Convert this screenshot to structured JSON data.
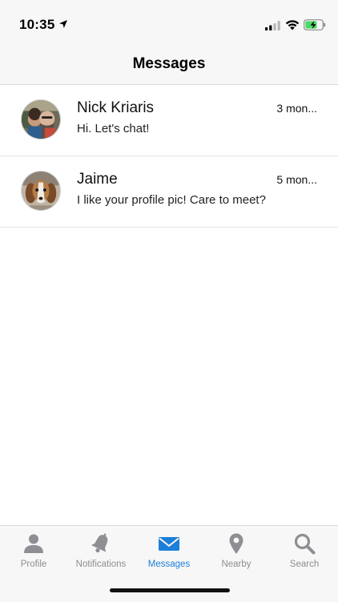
{
  "status_bar": {
    "time": "10:35",
    "icons": [
      "location-arrow-icon",
      "cellular-signal-icon",
      "wifi-icon",
      "battery-charging-icon"
    ],
    "battery_color": "#4cd964"
  },
  "header": {
    "title": "Messages"
  },
  "messages": [
    {
      "name": "Nick Kriaris",
      "time": "3 mon...",
      "preview": " Hi. Let's chat!",
      "avatar": "couple-photo-avatar"
    },
    {
      "name": "Jaime",
      "time": "5 mon...",
      "preview": "I like your profile pic! Care to meet?",
      "avatar": "dog-photo-avatar"
    }
  ],
  "tab_bar": {
    "active_color": "#1c7fd8",
    "inactive_color": "#8e8e93",
    "tabs": [
      {
        "label": "Profile",
        "icon": "person-icon",
        "active": false
      },
      {
        "label": "Notifications",
        "icon": "bell-icon",
        "active": false
      },
      {
        "label": "Messages",
        "icon": "envelope-icon",
        "active": true
      },
      {
        "label": "Nearby",
        "icon": "map-pin-icon",
        "active": false
      },
      {
        "label": "Search",
        "icon": "search-icon",
        "active": false
      }
    ]
  }
}
